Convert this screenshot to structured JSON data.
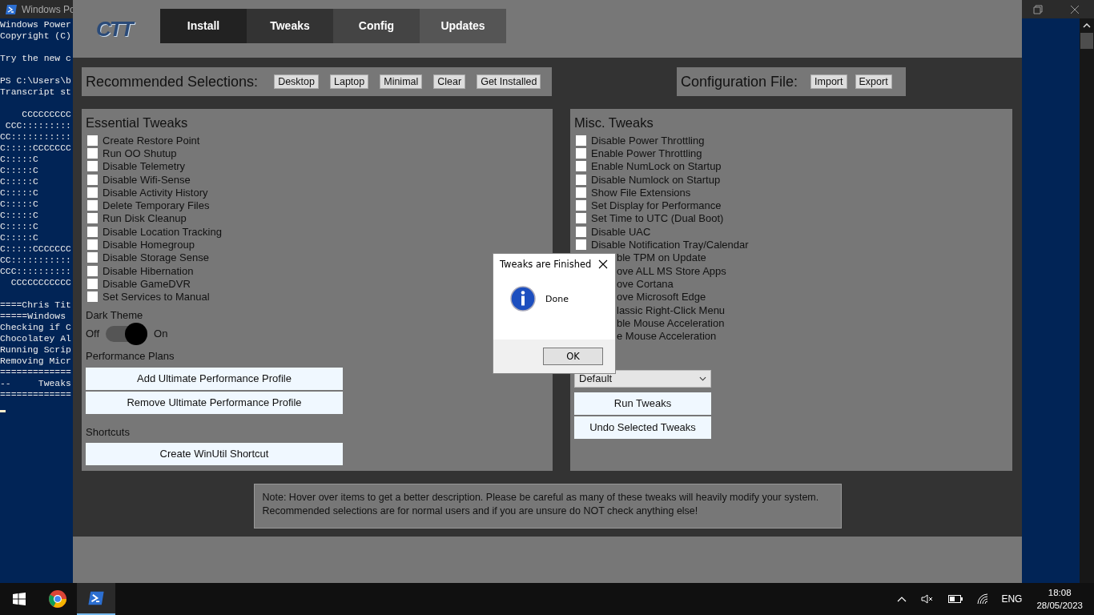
{
  "terminal": {
    "title": "Windows Po",
    "blocks": [
      [
        "Windows Power",
        "Copyright (C)"
      ],
      [
        "Try the new c"
      ],
      [
        "PS C:\\Users\\b",
        "Transcript st"
      ],
      [
        "    CCCCCCCCC",
        " CCC:::::::::",
        "CC:::::::::::",
        "C:::::CCCCCCC",
        "C:::::C",
        "C:::::C",
        "C:::::C",
        "C:::::C",
        "C:::::C",
        "C:::::C",
        "C:::::C",
        "C:::::C",
        "C:::::CCCCCCC",
        "CC:::::::::::",
        "CCC::::::::::",
        "  CCCCCCCCCCC"
      ],
      [
        "====Chris Tit",
        "=====Windows",
        "Checking if C",
        "Chocolatey Al",
        "Running Scrip",
        "Removing Micr",
        "=============",
        "--     Tweaks",
        "============="
      ]
    ]
  },
  "app": {
    "logo": "CTT",
    "tabs": [
      {
        "label": "Install",
        "color": "#222222"
      },
      {
        "label": "Tweaks",
        "color": "#333333"
      },
      {
        "label": "Config",
        "color": "#444444"
      },
      {
        "label": "Updates",
        "color": "#555555"
      }
    ],
    "recommended": {
      "label": "Recommended Selections:",
      "buttons": [
        "Desktop",
        "Laptop",
        "Minimal",
        "Clear",
        "Get Installed"
      ]
    },
    "config_file": {
      "label": "Configuration File:",
      "buttons": [
        "Import",
        "Export"
      ]
    },
    "essential": {
      "title": "Essential Tweaks",
      "items": [
        {
          "label": "Create Restore Point",
          "checked": false
        },
        {
          "label": "Run OO Shutup",
          "checked": false
        },
        {
          "label": "Disable Telemetry",
          "checked": false
        },
        {
          "label": "Disable Wifi-Sense",
          "checked": false
        },
        {
          "label": "Disable Activity History",
          "checked": false
        },
        {
          "label": "Delete Temporary Files",
          "checked": false
        },
        {
          "label": "Run Disk Cleanup",
          "checked": false
        },
        {
          "label": "Disable Location Tracking",
          "checked": false
        },
        {
          "label": "Disable Homegroup",
          "checked": false
        },
        {
          "label": "Disable Storage Sense",
          "checked": false
        },
        {
          "label": "Disable Hibernation",
          "checked": false
        },
        {
          "label": "Disable GameDVR",
          "checked": false
        },
        {
          "label": "Set Services to Manual",
          "checked": false
        }
      ],
      "dark_theme": {
        "label": "Dark Theme",
        "off_label": "Off",
        "on_label": "On",
        "on": true
      },
      "performance_label": "Performance Plans",
      "performance_buttons": [
        "Add Ultimate Performance Profile",
        "Remove Ultimate Performance Profile"
      ],
      "shortcuts_label": "Shortcuts",
      "shortcut_button": "Create WinUtil Shortcut"
    },
    "misc": {
      "title": "Misc. Tweaks",
      "items": [
        {
          "kind": "checkbox",
          "label": "Disable Power Throttling",
          "checked": false
        },
        {
          "kind": "checkbox",
          "label": "Enable Power Throttling",
          "checked": false
        },
        {
          "kind": "checkbox",
          "label": "Enable NumLock on Startup",
          "checked": false
        },
        {
          "kind": "checkbox",
          "label": "Disable Numlock on Startup",
          "checked": false
        },
        {
          "kind": "checkbox",
          "label": "Show File Extensions",
          "checked": false
        },
        {
          "kind": "checkbox",
          "label": "Set Display for Performance",
          "checked": false
        },
        {
          "kind": "checkbox",
          "label": "Set Time to UTC (Dual Boot)",
          "checked": false
        },
        {
          "kind": "checkbox",
          "label": "Disable UAC",
          "checked": false
        },
        {
          "kind": "checkbox",
          "label": "Disable Notification Tray/Calendar",
          "checked": false
        },
        {
          "kind": "covered",
          "label": "ble TPM on Update"
        },
        {
          "kind": "covered",
          "label": "ove ALL MS Store Apps"
        },
        {
          "kind": "covered",
          "label": "ove Cortana"
        },
        {
          "kind": "covered",
          "label": "ove Microsoft Edge"
        },
        {
          "kind": "covered",
          "label": "lassic Right-Click Menu"
        },
        {
          "kind": "covered",
          "label": "ble Mouse Acceleration"
        },
        {
          "kind": "covered",
          "label": "e Mouse Acceleration"
        }
      ],
      "dropdown": {
        "value": "Default"
      },
      "buttons": [
        "Run Tweaks",
        "Undo Selected Tweaks"
      ]
    },
    "note": "Note: Hover over items to get a better description. Please be careful as many of these tweaks will heavily modify your system.\nRecommended selections are for normal users and if you are unsure do NOT check anything else!"
  },
  "dialog": {
    "title": "Tweaks are Finished",
    "message": "Done",
    "button": "OK"
  },
  "taskbar": {
    "apps": [
      {
        "kind": "chrome",
        "selected": false
      },
      {
        "kind": "powershell",
        "selected": true
      }
    ],
    "language": "ENG",
    "time": "18:08",
    "date": "28/05/2023"
  }
}
